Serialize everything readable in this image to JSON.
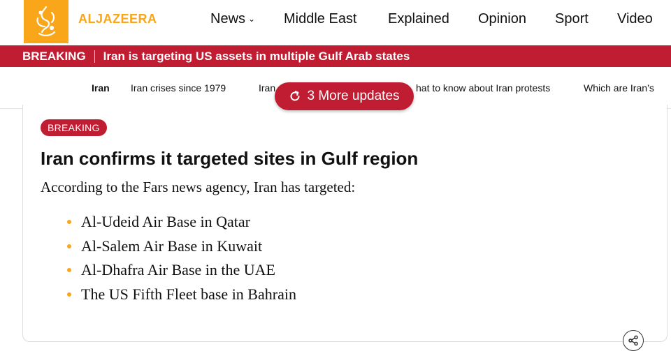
{
  "brand": {
    "name": "ALJAZEERA",
    "color": "#f9a61a",
    "icon": "aljazeera-calligraphy-logo"
  },
  "nav": {
    "items": [
      {
        "label": "News",
        "has_dropdown": true
      },
      {
        "label": "Middle East"
      },
      {
        "label": "Explained"
      },
      {
        "label": "Opinion"
      },
      {
        "label": "Sport"
      },
      {
        "label": "Video"
      }
    ]
  },
  "breaking_bar": {
    "label": "BREAKING",
    "text": "Iran is targeting US assets in multiple Gulf Arab states",
    "color": "#c01d33"
  },
  "topics": [
    {
      "label": "Iran",
      "active": true
    },
    {
      "label": "Iran crises since 1979"
    },
    {
      "label": "Iran"
    },
    {
      "label": "hat to know about Iran protests"
    },
    {
      "label": "Which are Iran’s"
    }
  ],
  "updates_button": {
    "icon": "refresh-icon",
    "label": "3 More updates"
  },
  "post": {
    "badge": "BREAKING",
    "headline": "Iran confirms it targeted sites in Gulf region",
    "intro": "According to the Fars news agency, Iran has targeted:",
    "bullets": [
      "Al-Udeid Air Base in Qatar",
      "Al-Salem Air Base in Kuwait",
      "Al-Dhafra Air Base in the UAE",
      "The US Fifth Fleet base in Bahrain"
    ],
    "share_icon": "share-icon"
  }
}
